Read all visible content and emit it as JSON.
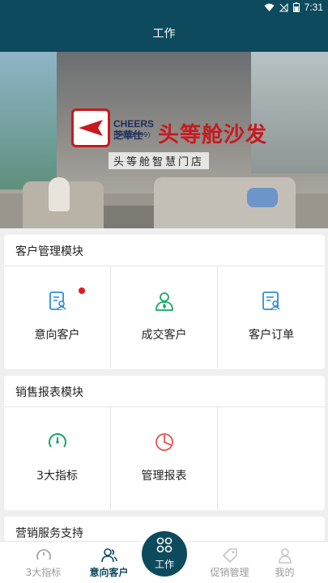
{
  "status_bar": {
    "time": "7:31"
  },
  "header": {
    "title": "工作"
  },
  "banner": {
    "brand_name": "CHEERS",
    "brand_cn": "芝華仕",
    "brand_code": "(HK 01999)",
    "brand_title": "头等舱沙发",
    "store_name": "头等舱智慧门店",
    "slide_count": 3,
    "active_slide": 2
  },
  "customer_module": {
    "title": "客户管理模块",
    "items": [
      {
        "label": "意向客户",
        "icon": "user-file-icon",
        "has_badge": true
      },
      {
        "label": "成交客户",
        "icon": "user-tie-icon",
        "has_badge": false
      },
      {
        "label": "客户订单",
        "icon": "order-doc-icon",
        "has_badge": false
      }
    ]
  },
  "sales_module": {
    "title": "销售报表模块",
    "items": [
      {
        "label": "3大指标",
        "icon": "gauge-icon"
      },
      {
        "label": "管理报表",
        "icon": "pie-chart-icon"
      }
    ]
  },
  "marketing_module": {
    "title": "营销服务支持"
  },
  "tabbar": {
    "tabs": [
      {
        "label": "3大指标",
        "icon": "gauge-icon"
      },
      {
        "label": "意向客户",
        "icon": "users-icon",
        "active": true
      },
      {
        "label": "工作",
        "icon": "grid-icon"
      },
      {
        "label": "促销管理",
        "icon": "tag-icon"
      },
      {
        "label": "我的",
        "icon": "person-icon"
      }
    ]
  },
  "colors": {
    "primary": "#0d4a5e",
    "icon_blue": "#2e8fd6",
    "icon_green": "#17a865",
    "icon_red": "#e8564f",
    "badge_red": "#e6191e",
    "brand_red": "#c8191e"
  }
}
